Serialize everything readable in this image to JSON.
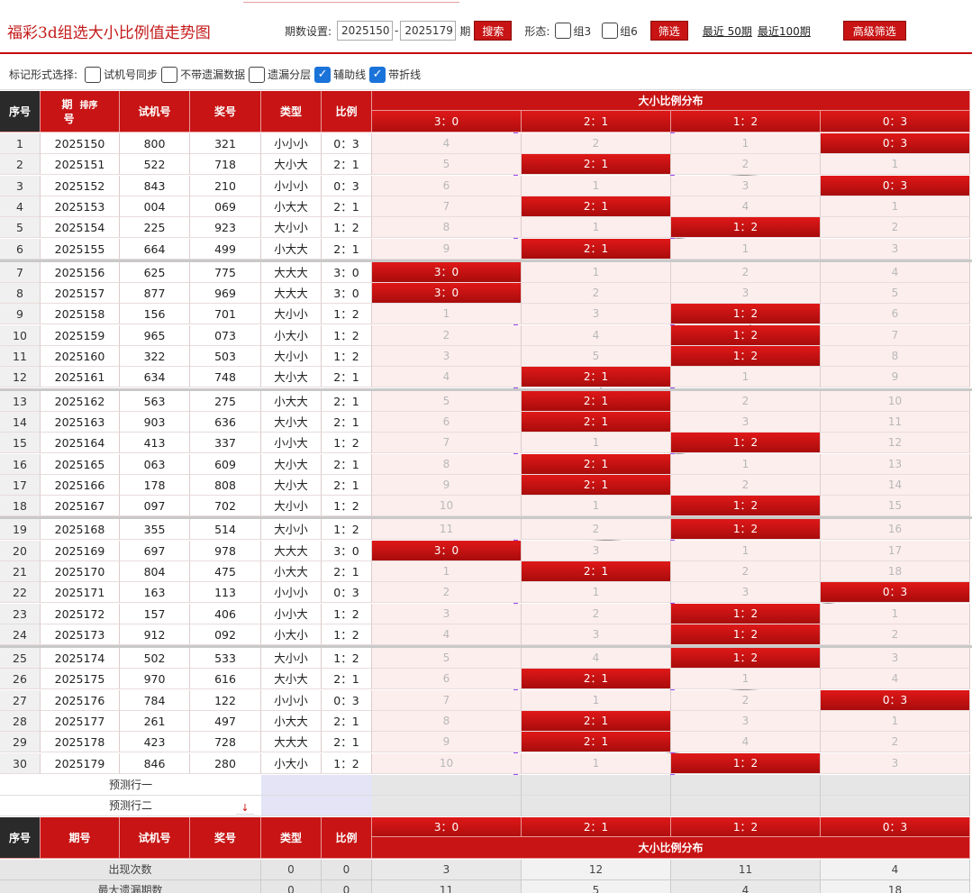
{
  "header": {
    "title": "福彩3d组选大小比例值走势图",
    "period_label": "期数设置:",
    "from": "2025150",
    "dash": "-",
    "to": "2025179",
    "period_unit": "期",
    "search": "搜索",
    "form_label": "形态:",
    "group3": "组3",
    "group6": "组6",
    "filter": "筛选",
    "recent50": "最近 50期",
    "recent100": "最近100期",
    "advanced": "高级筛选"
  },
  "options": {
    "label": "标记形式选择:",
    "items": [
      {
        "label": "试机号同步",
        "checked": false
      },
      {
        "label": "不带遗漏数据",
        "checked": false
      },
      {
        "label": "遗漏分层",
        "checked": false
      },
      {
        "label": "辅助线",
        "checked": true
      },
      {
        "label": "带折线",
        "checked": true
      }
    ]
  },
  "columns": {
    "idx": "序号",
    "issue_a": "期",
    "issue_b": "号",
    "sort": "排序",
    "test": "试机号",
    "prize": "奖号",
    "type": "类型",
    "ratio": "比例",
    "dist_title": "大小比例分布",
    "dist": [
      "3：0",
      "2：1",
      "1：2",
      "0：3"
    ]
  },
  "rows": [
    {
      "idx": "1",
      "issue": "2025150",
      "test": "800",
      "prize": "321",
      "type": "小小小",
      "ratio": "0：3",
      "hit": 3,
      "miss": [
        "4",
        "2",
        "1",
        ""
      ]
    },
    {
      "idx": "2",
      "issue": "2025151",
      "test": "522",
      "prize": "718",
      "type": "大小大",
      "ratio": "2：1",
      "hit": 1,
      "miss": [
        "5",
        "",
        "2",
        "1"
      ]
    },
    {
      "idx": "3",
      "issue": "2025152",
      "test": "843",
      "prize": "210",
      "type": "小小小",
      "ratio": "0：3",
      "hit": 3,
      "miss": [
        "6",
        "1",
        "3",
        ""
      ]
    },
    {
      "idx": "4",
      "issue": "2025153",
      "test": "004",
      "prize": "069",
      "type": "小大大",
      "ratio": "2：1",
      "hit": 1,
      "miss": [
        "7",
        "",
        "4",
        "1"
      ]
    },
    {
      "idx": "5",
      "issue": "2025154",
      "test": "225",
      "prize": "923",
      "type": "大小小",
      "ratio": "1：2",
      "hit": 2,
      "miss": [
        "8",
        "1",
        "",
        "2"
      ]
    },
    {
      "idx": "6",
      "issue": "2025155",
      "test": "664",
      "prize": "499",
      "type": "小大大",
      "ratio": "2：1",
      "hit": 1,
      "miss": [
        "9",
        "",
        "1",
        "3"
      ]
    },
    {
      "idx": "7",
      "issue": "2025156",
      "test": "625",
      "prize": "775",
      "type": "大大大",
      "ratio": "3：0",
      "hit": 0,
      "miss": [
        "",
        "1",
        "2",
        "4"
      ]
    },
    {
      "idx": "8",
      "issue": "2025157",
      "test": "877",
      "prize": "969",
      "type": "大大大",
      "ratio": "3：0",
      "hit": 0,
      "miss": [
        "",
        "2",
        "3",
        "5"
      ]
    },
    {
      "idx": "9",
      "issue": "2025158",
      "test": "156",
      "prize": "701",
      "type": "大小小",
      "ratio": "1：2",
      "hit": 2,
      "miss": [
        "1",
        "3",
        "",
        "6"
      ]
    },
    {
      "idx": "10",
      "issue": "2025159",
      "test": "965",
      "prize": "073",
      "type": "小大小",
      "ratio": "1：2",
      "hit": 2,
      "miss": [
        "2",
        "4",
        "",
        "7"
      ]
    },
    {
      "idx": "11",
      "issue": "2025160",
      "test": "322",
      "prize": "503",
      "type": "大小小",
      "ratio": "1：2",
      "hit": 2,
      "miss": [
        "3",
        "5",
        "",
        "8"
      ]
    },
    {
      "idx": "12",
      "issue": "2025161",
      "test": "634",
      "prize": "748",
      "type": "大小大",
      "ratio": "2：1",
      "hit": 1,
      "miss": [
        "4",
        "",
        "1",
        "9"
      ]
    },
    {
      "idx": "13",
      "issue": "2025162",
      "test": "563",
      "prize": "275",
      "type": "小大大",
      "ratio": "2：1",
      "hit": 1,
      "miss": [
        "5",
        "",
        "2",
        "10"
      ]
    },
    {
      "idx": "14",
      "issue": "2025163",
      "test": "903",
      "prize": "636",
      "type": "大小大",
      "ratio": "2：1",
      "hit": 1,
      "miss": [
        "6",
        "",
        "3",
        "11"
      ]
    },
    {
      "idx": "15",
      "issue": "2025164",
      "test": "413",
      "prize": "337",
      "type": "小小大",
      "ratio": "1：2",
      "hit": 2,
      "miss": [
        "7",
        "1",
        "",
        "12"
      ]
    },
    {
      "idx": "16",
      "issue": "2025165",
      "test": "063",
      "prize": "609",
      "type": "大小大",
      "ratio": "2：1",
      "hit": 1,
      "miss": [
        "8",
        "",
        "1",
        "13"
      ]
    },
    {
      "idx": "17",
      "issue": "2025166",
      "test": "178",
      "prize": "808",
      "type": "大小大",
      "ratio": "2：1",
      "hit": 1,
      "miss": [
        "9",
        "",
        "2",
        "14"
      ]
    },
    {
      "idx": "18",
      "issue": "2025167",
      "test": "097",
      "prize": "702",
      "type": "大小小",
      "ratio": "1：2",
      "hit": 2,
      "miss": [
        "10",
        "1",
        "",
        "15"
      ]
    },
    {
      "idx": "19",
      "issue": "2025168",
      "test": "355",
      "prize": "514",
      "type": "大小小",
      "ratio": "1：2",
      "hit": 2,
      "miss": [
        "11",
        "2",
        "",
        "16"
      ]
    },
    {
      "idx": "20",
      "issue": "2025169",
      "test": "697",
      "prize": "978",
      "type": "大大大",
      "ratio": "3：0",
      "hit": 0,
      "miss": [
        "",
        "3",
        "1",
        "17"
      ]
    },
    {
      "idx": "21",
      "issue": "2025170",
      "test": "804",
      "prize": "475",
      "type": "小大大",
      "ratio": "2：1",
      "hit": 1,
      "miss": [
        "1",
        "",
        "2",
        "18"
      ]
    },
    {
      "idx": "22",
      "issue": "2025171",
      "test": "163",
      "prize": "113",
      "type": "小小小",
      "ratio": "0：3",
      "hit": 3,
      "miss": [
        "2",
        "1",
        "3",
        ""
      ]
    },
    {
      "idx": "23",
      "issue": "2025172",
      "test": "157",
      "prize": "406",
      "type": "小小大",
      "ratio": "1：2",
      "hit": 2,
      "miss": [
        "3",
        "2",
        "",
        "1"
      ]
    },
    {
      "idx": "24",
      "issue": "2025173",
      "test": "912",
      "prize": "092",
      "type": "小大小",
      "ratio": "1：2",
      "hit": 2,
      "miss": [
        "4",
        "3",
        "",
        "2"
      ]
    },
    {
      "idx": "25",
      "issue": "2025174",
      "test": "502",
      "prize": "533",
      "type": "大小小",
      "ratio": "1：2",
      "hit": 2,
      "miss": [
        "5",
        "4",
        "",
        "3"
      ]
    },
    {
      "idx": "26",
      "issue": "2025175",
      "test": "970",
      "prize": "616",
      "type": "大小大",
      "ratio": "2：1",
      "hit": 1,
      "miss": [
        "6",
        "",
        "1",
        "4"
      ]
    },
    {
      "idx": "27",
      "issue": "2025176",
      "test": "784",
      "prize": "122",
      "type": "小小小",
      "ratio": "0：3",
      "hit": 3,
      "miss": [
        "7",
        "1",
        "2",
        ""
      ]
    },
    {
      "idx": "28",
      "issue": "2025177",
      "test": "261",
      "prize": "497",
      "type": "小大大",
      "ratio": "2：1",
      "hit": 1,
      "miss": [
        "8",
        "",
        "3",
        "1"
      ]
    },
    {
      "idx": "29",
      "issue": "2025178",
      "test": "423",
      "prize": "728",
      "type": "大大大",
      "ratio": "2：1",
      "hit": 1,
      "miss": [
        "9",
        "",
        "4",
        "2"
      ]
    },
    {
      "idx": "30",
      "issue": "2025179",
      "test": "846",
      "prize": "280",
      "type": "小大小",
      "ratio": "1：2",
      "hit": 2,
      "miss": [
        "10",
        "1",
        "",
        "3"
      ]
    }
  ],
  "predict": [
    "预测行一",
    "预测行二"
  ],
  "footer": {
    "stats": [
      {
        "label": "出现次数",
        "type": "0",
        "ratio": "0",
        "vals": [
          "3",
          "12",
          "11",
          "4"
        ]
      },
      {
        "label": "最大遗漏期数",
        "type": "0",
        "ratio": "0",
        "vals": [
          "11",
          "5",
          "4",
          "18"
        ]
      }
    ]
  },
  "colors": {
    "accent": "#c81414",
    "highlight": "#9b4df0",
    "line": "#999999"
  }
}
